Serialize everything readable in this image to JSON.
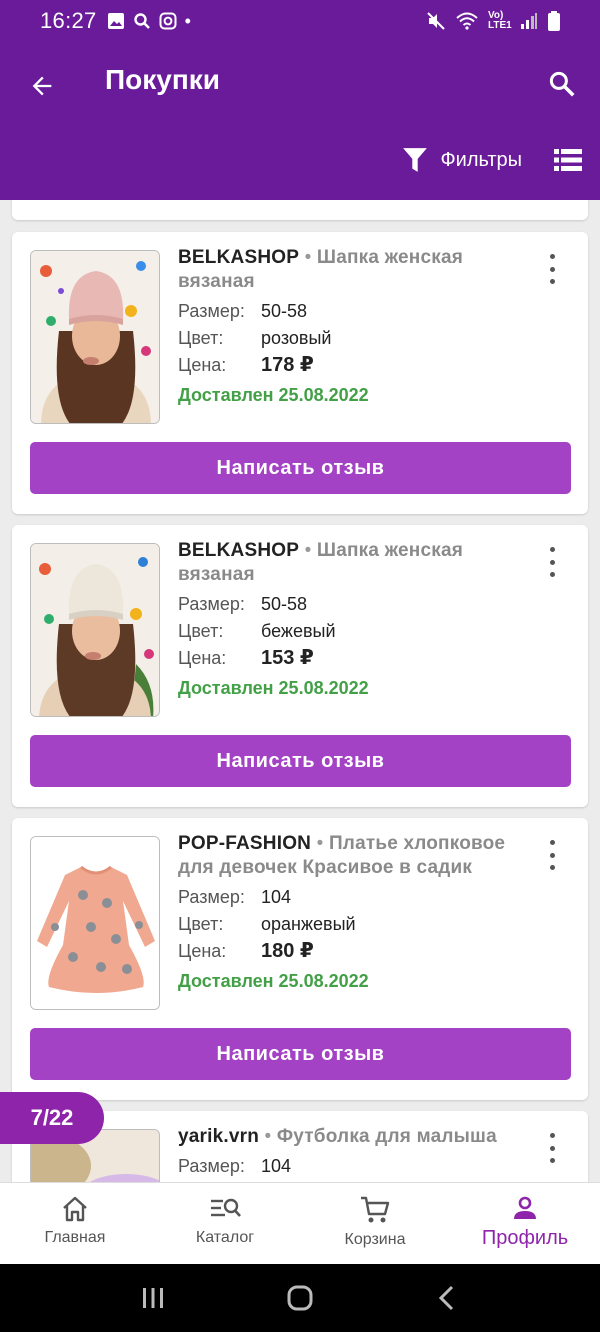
{
  "status_bar": {
    "time": "16:27",
    "network": "Vo) LTE1"
  },
  "header": {
    "title": "Покупки",
    "filters_label": "Фильтры"
  },
  "purchases": [
    {
      "brand": "BELKASHOP",
      "title": "Шапка женская вязаная",
      "size_label": "Размер:",
      "size": "50-58",
      "color_label": "Цвет:",
      "color": "розовый",
      "price_label": "Цена:",
      "price": "178 ₽",
      "status": "Доставлен 25.08.2022",
      "review_label": "Написать отзыв"
    },
    {
      "brand": "BELKASHOP",
      "title": "Шапка женская вязаная",
      "size_label": "Размер:",
      "size": "50-58",
      "color_label": "Цвет:",
      "color": "бежевый",
      "price_label": "Цена:",
      "price": "153 ₽",
      "status": "Доставлен 25.08.2022",
      "review_label": "Написать отзыв"
    },
    {
      "brand": "POP-FASHION",
      "title": "Платье хлопковое для девочек Красивое в садик",
      "size_label": "Размер:",
      "size": "104",
      "color_label": "Цвет:",
      "color": "оранжевый",
      "price_label": "Цена:",
      "price": "180 ₽",
      "status": "Доставлен 25.08.2022",
      "review_label": "Написать отзыв"
    },
    {
      "brand": "yarik.vrn",
      "title": "Футболка для малыша",
      "size_label": "Размер:",
      "size": "104"
    }
  ],
  "counter": "7/22",
  "bottom_nav": [
    {
      "label": "Главная",
      "icon": "home-icon"
    },
    {
      "label": "Каталог",
      "icon": "catalog-search-icon"
    },
    {
      "label": "Корзина",
      "icon": "cart-icon"
    },
    {
      "label": "Профиль",
      "icon": "profile-icon",
      "active": true
    }
  ],
  "colors": {
    "primary": "#6a1b9a",
    "button": "#a342c4",
    "accent": "#8e24aa",
    "delivered": "#43a047"
  }
}
